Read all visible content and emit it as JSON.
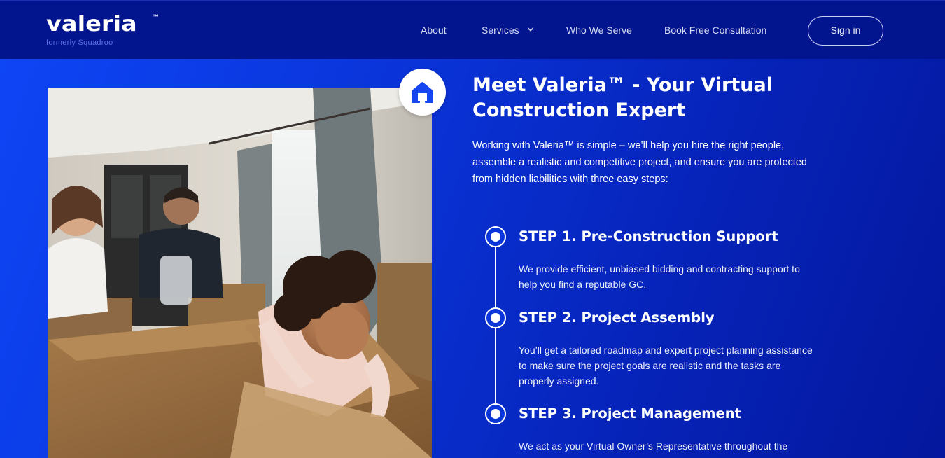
{
  "header": {
    "logo_text": "valeria",
    "logo_tm": "™",
    "logo_sub": "formerly Squadroo",
    "nav": {
      "about": "About",
      "services": "Services",
      "who_we_serve": "Who We Serve",
      "consultation": "Book Free Consultation"
    },
    "signin": "Sign in"
  },
  "hero": {
    "title": "Meet Valeria™ - Your Virtual Construction Expert",
    "intro": "Working with Valeria™ is simple – we’ll help you hire the right people, assemble a realistic and competitive project, and ensure you are protected from hidden liabilities with three easy steps:",
    "badge_icon": "home-icon",
    "steps": [
      {
        "title": "STEP 1. Pre-Construction Support",
        "text": "We provide efficient, unbiased bidding and contracting support to help you find a reputable GC."
      },
      {
        "title": "STEP 2. Project Assembly",
        "text": "You’ll get a tailored roadmap and expert project planning assistance to make sure the project goals are realistic and the tasks are properly assigned."
      },
      {
        "title": "STEP 3. Project Management",
        "text": "We act as your Virtual Owner’s Representative throughout the"
      }
    ]
  },
  "colors": {
    "header_bg": "#03148f",
    "main_gradient_start": "#0e45f5",
    "main_gradient_end": "#04179d",
    "badge_icon": "#1646f0"
  }
}
